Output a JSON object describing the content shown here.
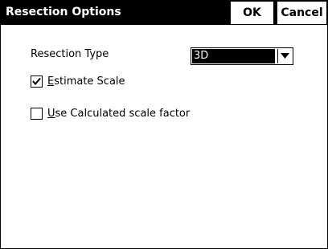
{
  "dialog": {
    "title": "Resection Options",
    "ok_label": "OK",
    "cancel_label": "Cancel"
  },
  "resection_type": {
    "label": "Resection Type",
    "selected": "3D",
    "arrow_icon": "chevron-down-icon"
  },
  "estimate_scale": {
    "mnemonic": "E",
    "rest": "stimate Scale",
    "checked": true
  },
  "use_calculated": {
    "mnemonic": "U",
    "rest": "se Calculated scale factor",
    "checked": false
  },
  "colors": {
    "titlebar": "#000000",
    "title_text": "#ffffff",
    "background": "#ffffff",
    "selection": "#000000"
  }
}
